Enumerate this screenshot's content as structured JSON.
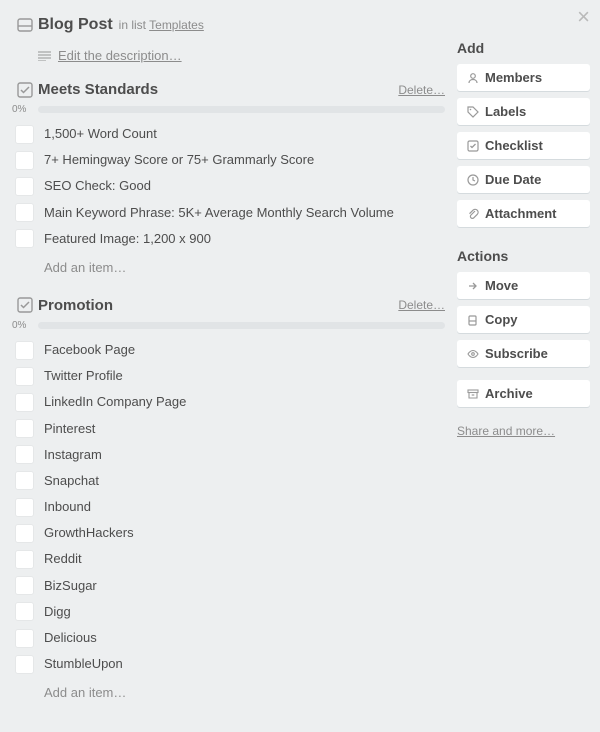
{
  "header": {
    "title": "Blog Post",
    "in_list_prefix": "in list",
    "list_name": "Templates"
  },
  "description": {
    "edit_label": "Edit the description…"
  },
  "checklists": [
    {
      "title": "Meets Standards",
      "delete_label": "Delete…",
      "percent": "0%",
      "add_label": "Add an item…",
      "items": [
        "1,500+ Word Count",
        "7+ Hemingway Score or 75+ Grammarly Score",
        "SEO Check: Good",
        "Main Keyword Phrase: 5K+ Average Monthly Search Volume",
        "Featured Image: 1,200 x 900"
      ]
    },
    {
      "title": "Promotion",
      "delete_label": "Delete…",
      "percent": "0%",
      "add_label": "Add an item…",
      "items": [
        "Facebook Page",
        "Twitter Profile",
        "LinkedIn Company Page",
        "Pinterest",
        "Instagram",
        "Snapchat",
        "Inbound",
        "GrowthHackers",
        "Reddit",
        "BizSugar",
        "Digg",
        "Delicious",
        "StumbleUpon"
      ]
    }
  ],
  "sidebar": {
    "add_heading": "Add",
    "actions_heading": "Actions",
    "members": "Members",
    "labels": "Labels",
    "checklist": "Checklist",
    "due_date": "Due Date",
    "attachment": "Attachment",
    "move": "Move",
    "copy": "Copy",
    "subscribe": "Subscribe",
    "archive": "Archive",
    "share": "Share and more…"
  }
}
